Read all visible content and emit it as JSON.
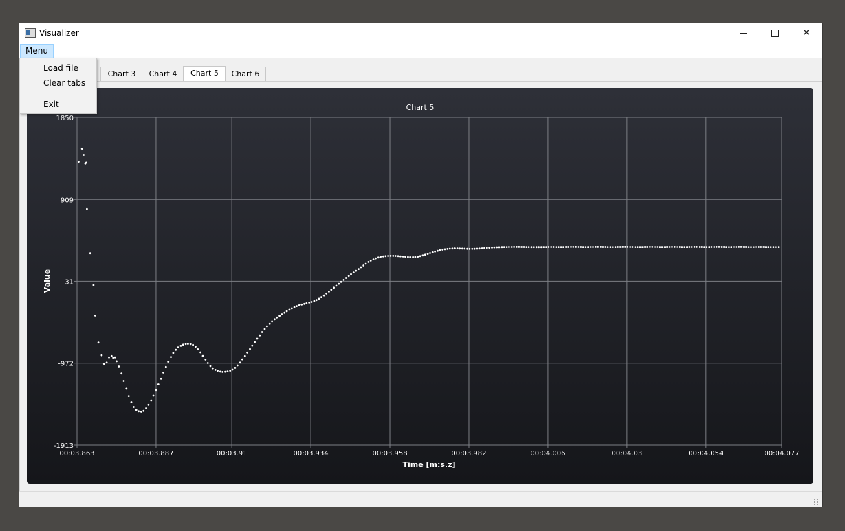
{
  "window": {
    "title": "Visualizer",
    "controls": {
      "minimize": "—",
      "maximize": "☐",
      "close": "✕"
    }
  },
  "menubar": {
    "menu_label": "Menu"
  },
  "menu": {
    "items": [
      "Load file",
      "Clear tabs",
      "Exit"
    ]
  },
  "tabs": [
    {
      "label": "Chart 3"
    },
    {
      "label": "Chart 4"
    },
    {
      "label": "Chart 5",
      "active": true
    },
    {
      "label": "Chart 6"
    }
  ],
  "colors": {
    "chart_bg_top": "#2e3038",
    "chart_bg_bottom": "#15161a",
    "grid": "#7d7f85",
    "points": "#ffffff",
    "text": "#ffffff"
  },
  "chart_data": {
    "type": "scatter",
    "title": "Chart 5",
    "xlabel": "Time [m:s.z]",
    "ylabel": "Value",
    "xlim": [
      3.863,
      4.077
    ],
    "ylim": [
      -1913,
      1850
    ],
    "grid": true,
    "x_ticks": [
      {
        "v": 3.863,
        "label": "00:03.863"
      },
      {
        "v": 3.887,
        "label": "00:03.887"
      },
      {
        "v": 3.91,
        "label": "00:03.91"
      },
      {
        "v": 3.934,
        "label": "00:03.934"
      },
      {
        "v": 3.958,
        "label": "00:03.958"
      },
      {
        "v": 3.982,
        "label": "00:03.982"
      },
      {
        "v": 4.006,
        "label": "00:04.006"
      },
      {
        "v": 4.03,
        "label": "00:04.03"
      },
      {
        "v": 4.054,
        "label": "00:04.054"
      },
      {
        "v": 4.077,
        "label": "00:04.077"
      }
    ],
    "y_ticks": [
      {
        "v": 1850,
        "label": "1850"
      },
      {
        "v": 909,
        "label": "909"
      },
      {
        "v": -31,
        "label": "-31"
      },
      {
        "v": -972,
        "label": "-972"
      },
      {
        "v": -1913,
        "label": "-1913"
      }
    ],
    "series": [
      {
        "points": [
          [
            3.8635,
            1340
          ],
          [
            3.8645,
            1490
          ],
          [
            3.865,
            1420
          ],
          [
            3.8655,
            1320
          ],
          [
            3.8658,
            1330
          ],
          [
            3.866,
            800
          ],
          [
            3.867,
            290
          ],
          [
            3.868,
            -75
          ],
          [
            3.8685,
            -425
          ],
          [
            3.8695,
            -735
          ],
          [
            3.8705,
            -880
          ],
          [
            3.8712,
            -980
          ],
          [
            3.872,
            -965
          ],
          [
            3.8727,
            -905
          ],
          [
            3.8735,
            -890
          ],
          [
            3.874,
            -910
          ],
          [
            3.8745,
            -905
          ],
          [
            3.875,
            -950
          ],
          [
            3.8757,
            -1010
          ],
          [
            3.8765,
            -1090
          ],
          [
            3.8772,
            -1175
          ],
          [
            3.878,
            -1265
          ],
          [
            3.8787,
            -1350
          ],
          [
            3.8795,
            -1420
          ],
          [
            3.8802,
            -1475
          ],
          [
            3.881,
            -1510
          ],
          [
            3.8817,
            -1525
          ],
          [
            3.8825,
            -1530
          ],
          [
            3.8832,
            -1520
          ],
          [
            3.884,
            -1490
          ],
          [
            3.8847,
            -1450
          ],
          [
            3.8855,
            -1400
          ],
          [
            3.8862,
            -1345
          ],
          [
            3.887,
            -1280
          ],
          [
            3.8877,
            -1215
          ],
          [
            3.8885,
            -1150
          ],
          [
            3.8892,
            -1080
          ],
          [
            3.89,
            -1015
          ],
          [
            3.8907,
            -955
          ],
          [
            3.8915,
            -900
          ],
          [
            3.8922,
            -855
          ],
          [
            3.893,
            -818
          ],
          [
            3.8937,
            -790
          ],
          [
            3.8945,
            -772
          ],
          [
            3.8952,
            -760
          ],
          [
            3.896,
            -752
          ],
          [
            3.8967,
            -750
          ],
          [
            3.8975,
            -752
          ],
          [
            3.8982,
            -762
          ],
          [
            3.899,
            -782
          ],
          [
            3.8997,
            -812
          ],
          [
            3.9005,
            -848
          ],
          [
            3.9012,
            -888
          ],
          [
            3.902,
            -930
          ],
          [
            3.9027,
            -970
          ],
          [
            3.9035,
            -1005
          ],
          [
            3.9042,
            -1030
          ],
          [
            3.905,
            -1048
          ],
          [
            3.9057,
            -1058
          ],
          [
            3.9065,
            -1068
          ],
          [
            3.9072,
            -1072
          ],
          [
            3.908,
            -1070
          ],
          [
            3.9087,
            -1066
          ],
          [
            3.9095,
            -1058
          ],
          [
            3.9102,
            -1045
          ],
          [
            3.911,
            -1025
          ],
          [
            3.9117,
            -998
          ],
          [
            3.9125,
            -965
          ],
          [
            3.9132,
            -928
          ],
          [
            3.914,
            -890
          ],
          [
            3.9147,
            -850
          ],
          [
            3.9155,
            -810
          ],
          [
            3.9162,
            -770
          ],
          [
            3.917,
            -730
          ],
          [
            3.9177,
            -690
          ],
          [
            3.9185,
            -652
          ],
          [
            3.9192,
            -615
          ],
          [
            3.92,
            -580
          ],
          [
            3.9207,
            -548
          ],
          [
            3.9215,
            -518
          ],
          [
            3.9222,
            -492
          ],
          [
            3.923,
            -468
          ],
          [
            3.9237,
            -448
          ],
          [
            3.9245,
            -428
          ],
          [
            3.9252,
            -410
          ],
          [
            3.926,
            -392
          ],
          [
            3.9267,
            -375
          ],
          [
            3.9275,
            -358
          ],
          [
            3.9282,
            -342
          ],
          [
            3.929,
            -328
          ],
          [
            3.9297,
            -316
          ],
          [
            3.9305,
            -306
          ],
          [
            3.9312,
            -298
          ],
          [
            3.932,
            -290
          ],
          [
            3.9327,
            -283
          ],
          [
            3.9335,
            -276
          ],
          [
            3.9342,
            -268
          ],
          [
            3.935,
            -258
          ],
          [
            3.9357,
            -246
          ],
          [
            3.9365,
            -232
          ],
          [
            3.9372,
            -214
          ],
          [
            3.938,
            -194
          ],
          [
            3.9387,
            -172
          ],
          [
            3.9395,
            -150
          ],
          [
            3.9402,
            -128
          ],
          [
            3.941,
            -105
          ],
          [
            3.9417,
            -82
          ],
          [
            3.9425,
            -60
          ],
          [
            3.9432,
            -38
          ],
          [
            3.944,
            -15
          ],
          [
            3.9447,
            8
          ],
          [
            3.9455,
            30
          ],
          [
            3.9462,
            50
          ],
          [
            3.947,
            70
          ],
          [
            3.9477,
            90
          ],
          [
            3.9485,
            110
          ],
          [
            3.9492,
            130
          ],
          [
            3.95,
            150
          ],
          [
            3.9507,
            170
          ],
          [
            3.9515,
            190
          ],
          [
            3.9522,
            205
          ],
          [
            3.953,
            220
          ],
          [
            3.9537,
            232
          ],
          [
            3.9545,
            242
          ],
          [
            3.9552,
            250
          ],
          [
            3.956,
            255
          ],
          [
            3.9567,
            258
          ],
          [
            3.9575,
            260
          ],
          [
            3.9582,
            261
          ],
          [
            3.959,
            261
          ],
          [
            3.9597,
            260
          ],
          [
            3.9605,
            258
          ],
          [
            3.9612,
            256
          ],
          [
            3.962,
            253
          ],
          [
            3.9627,
            250
          ],
          [
            3.9635,
            248
          ],
          [
            3.9642,
            246
          ],
          [
            3.965,
            246
          ],
          [
            3.9657,
            248
          ],
          [
            3.9665,
            252
          ],
          [
            3.9672,
            258
          ],
          [
            3.968,
            266
          ],
          [
            3.9687,
            274
          ],
          [
            3.9695,
            283
          ],
          [
            3.9702,
            292
          ],
          [
            3.971,
            301
          ],
          [
            3.9717,
            310
          ],
          [
            3.9725,
            318
          ],
          [
            3.9732,
            325
          ],
          [
            3.974,
            331
          ],
          [
            3.9747,
            336
          ],
          [
            3.9755,
            340
          ],
          [
            3.9762,
            343
          ],
          [
            3.977,
            345
          ],
          [
            3.9777,
            346
          ],
          [
            3.9785,
            346
          ],
          [
            3.9792,
            345
          ],
          [
            3.98,
            344
          ],
          [
            3.9807,
            343
          ],
          [
            3.9815,
            342
          ],
          [
            3.9822,
            341
          ],
          [
            3.983,
            341
          ],
          [
            3.9837,
            342
          ],
          [
            3.9845,
            343
          ],
          [
            3.9852,
            345
          ],
          [
            3.986,
            347
          ],
          [
            3.9867,
            350
          ],
          [
            3.9875,
            352
          ],
          [
            3.9882,
            354
          ],
          [
            3.989,
            356
          ],
          [
            3.9897,
            358
          ],
          [
            3.9905,
            359
          ],
          [
            3.9912,
            360
          ],
          [
            3.992,
            361
          ],
          [
            3.9927,
            362
          ],
          [
            3.9935,
            362
          ],
          [
            3.9942,
            363
          ],
          [
            3.995,
            363
          ],
          [
            3.9957,
            364
          ],
          [
            3.9965,
            364
          ],
          [
            3.9972,
            364
          ],
          [
            3.998,
            363
          ],
          [
            3.9987,
            363
          ],
          [
            3.9995,
            362
          ],
          [
            4.0002,
            362
          ],
          [
            4.001,
            361
          ],
          [
            4.0017,
            361
          ],
          [
            4.0025,
            361
          ],
          [
            4.0032,
            361
          ],
          [
            4.004,
            361
          ],
          [
            4.0047,
            362
          ],
          [
            4.0055,
            362
          ],
          [
            4.0062,
            363
          ],
          [
            4.007,
            363
          ],
          [
            4.0077,
            363
          ],
          [
            4.0085,
            362
          ],
          [
            4.0092,
            362
          ],
          [
            4.01,
            362
          ],
          [
            4.0107,
            362
          ],
          [
            4.0115,
            363
          ],
          [
            4.0122,
            363
          ],
          [
            4.013,
            364
          ],
          [
            4.0137,
            364
          ],
          [
            4.0145,
            364
          ],
          [
            4.0152,
            363
          ],
          [
            4.016,
            363
          ],
          [
            4.0167,
            362
          ],
          [
            4.0175,
            362
          ],
          [
            4.0182,
            362
          ],
          [
            4.019,
            363
          ],
          [
            4.0197,
            363
          ],
          [
            4.0205,
            364
          ],
          [
            4.0212,
            364
          ],
          [
            4.022,
            364
          ],
          [
            4.0227,
            363
          ],
          [
            4.0235,
            363
          ],
          [
            4.0242,
            362
          ],
          [
            4.025,
            362
          ],
          [
            4.0257,
            362
          ],
          [
            4.0265,
            362
          ],
          [
            4.0272,
            363
          ],
          [
            4.028,
            363
          ],
          [
            4.0287,
            364
          ],
          [
            4.0295,
            364
          ],
          [
            4.0302,
            364
          ],
          [
            4.031,
            363
          ],
          [
            4.0317,
            363
          ],
          [
            4.0325,
            362
          ],
          [
            4.0332,
            362
          ],
          [
            4.034,
            362
          ],
          [
            4.0347,
            362
          ],
          [
            4.0355,
            363
          ],
          [
            4.0362,
            363
          ],
          [
            4.037,
            364
          ],
          [
            4.0377,
            364
          ],
          [
            4.0385,
            363
          ],
          [
            4.0392,
            363
          ],
          [
            4.04,
            362
          ],
          [
            4.0407,
            362
          ],
          [
            4.0415,
            362
          ],
          [
            4.0422,
            363
          ],
          [
            4.043,
            363
          ],
          [
            4.0437,
            364
          ],
          [
            4.0445,
            364
          ],
          [
            4.0452,
            363
          ],
          [
            4.046,
            363
          ],
          [
            4.0467,
            362
          ],
          [
            4.0475,
            362
          ],
          [
            4.0482,
            362
          ],
          [
            4.049,
            363
          ],
          [
            4.0497,
            363
          ],
          [
            4.0505,
            364
          ],
          [
            4.0512,
            364
          ],
          [
            4.052,
            363
          ],
          [
            4.0527,
            363
          ],
          [
            4.0535,
            362
          ],
          [
            4.0542,
            362
          ],
          [
            4.055,
            362
          ],
          [
            4.0557,
            363
          ],
          [
            4.0565,
            363
          ],
          [
            4.0572,
            364
          ],
          [
            4.058,
            364
          ],
          [
            4.0587,
            363
          ],
          [
            4.0595,
            363
          ],
          [
            4.0602,
            362
          ],
          [
            4.061,
            362
          ],
          [
            4.0617,
            362
          ],
          [
            4.0625,
            363
          ],
          [
            4.0632,
            363
          ],
          [
            4.064,
            364
          ],
          [
            4.0647,
            364
          ],
          [
            4.0655,
            363
          ],
          [
            4.0662,
            363
          ],
          [
            4.067,
            362
          ],
          [
            4.0677,
            362
          ],
          [
            4.0685,
            362
          ],
          [
            4.0692,
            363
          ],
          [
            4.07,
            363
          ],
          [
            4.0707,
            363
          ],
          [
            4.0715,
            363
          ],
          [
            4.0722,
            362
          ],
          [
            4.073,
            362
          ],
          [
            4.0737,
            362
          ],
          [
            4.0745,
            362
          ],
          [
            4.0752,
            362
          ],
          [
            4.076,
            362
          ]
        ]
      }
    ]
  }
}
